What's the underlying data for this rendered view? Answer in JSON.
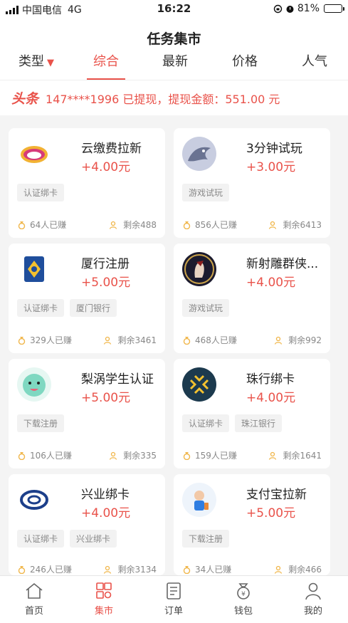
{
  "status_bar": {
    "carrier": "中国电信",
    "network": "4G",
    "time": "16:22",
    "battery": "81%",
    "battery_level": 0.81
  },
  "header": {
    "title": "任务集市"
  },
  "tabs": [
    {
      "label": "类型",
      "caret": "▼"
    },
    {
      "label": "综合"
    },
    {
      "label": "最新"
    },
    {
      "label": "价格"
    },
    {
      "label": "人气"
    }
  ],
  "headline": {
    "badge": "头条",
    "message": "147****1996 已提现，提现金额：551.00 元"
  },
  "tasks": [
    {
      "name": "云缴费拉新",
      "reward": "+4.00元",
      "tags": [
        "认证绑卡"
      ],
      "earned": "64人已赚",
      "remaining": "剩余488",
      "logo": "cloud-logo"
    },
    {
      "name": "3分钟试玩",
      "reward": "+3.00元",
      "tags": [
        "游戏试玩"
      ],
      "earned": "856人已赚",
      "remaining": "剩余6413",
      "logo": "dragon-logo"
    },
    {
      "name": "厦行注册",
      "reward": "+5.00元",
      "tags": [
        "认证绑卡",
        "厦门银行"
      ],
      "earned": "329人已赚",
      "remaining": "剩余3461",
      "logo": "xiamen-bank-logo"
    },
    {
      "name": "新射雕群侠...",
      "reward": "+4.00元",
      "tags": [
        "游戏试玩"
      ],
      "earned": "468人已赚",
      "remaining": "剩余992",
      "logo": "game-character-logo"
    },
    {
      "name": "梨涡学生认证",
      "reward": "+5.00元",
      "tags": [
        "下载注册"
      ],
      "earned": "106人已赚",
      "remaining": "剩余335",
      "logo": "liwo-logo"
    },
    {
      "name": "珠行绑卡",
      "reward": "+4.00元",
      "tags": [
        "认证绑卡",
        "珠江银行"
      ],
      "earned": "159人已赚",
      "remaining": "剩余1641",
      "logo": "zhuhai-bank-logo"
    },
    {
      "name": "兴业绑卡",
      "reward": "+4.00元",
      "tags": [
        "认证绑卡",
        "兴业绑卡"
      ],
      "earned": "246人已赚",
      "remaining": "剩余3134",
      "logo": "cib-logo"
    },
    {
      "name": "支付宝拉新",
      "reward": "+5.00元",
      "tags": [
        "下载注册"
      ],
      "earned": "34人已赚",
      "remaining": "剩余466",
      "logo": "alipay-character-logo"
    }
  ],
  "bottom_nav": [
    {
      "label": "首页",
      "icon": "home-icon"
    },
    {
      "label": "集市",
      "icon": "market-icon"
    },
    {
      "label": "订单",
      "icon": "order-icon"
    },
    {
      "label": "钱包",
      "icon": "wallet-icon"
    },
    {
      "label": "我的",
      "icon": "profile-icon"
    }
  ],
  "colors": {
    "accent": "#e9524a",
    "background": "#f4f4f4"
  }
}
